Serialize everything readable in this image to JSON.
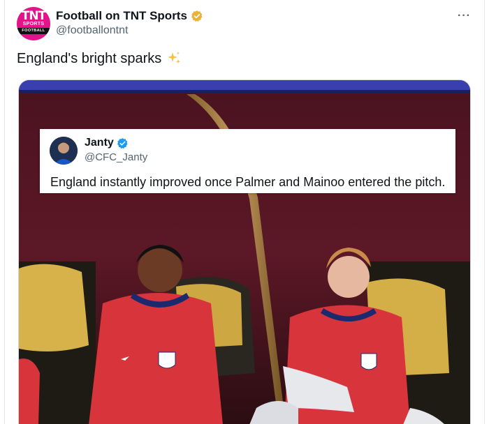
{
  "tweet": {
    "author": {
      "display_name": "Football on TNT Sports",
      "handle": "@footballontnt",
      "verified_badge": "gold-verified-icon",
      "avatar_text": {
        "logo": "TNT",
        "line1": "SPORTS",
        "line2": "FOOTBALL"
      }
    },
    "more_label": "···",
    "text": "England's bright sparks",
    "text_emoji": "sparkles-icon"
  },
  "media": {
    "quoted_post": {
      "display_name": "Janty",
      "handle": "@CFC_Janty",
      "verified_badge": "blue-verified-icon",
      "text": "England instantly improved once Palmer and Mainoo entered the pitch."
    }
  },
  "colors": {
    "brand_pink": "#e4138a",
    "text_primary": "#0f1419",
    "text_secondary": "#536471",
    "verified_gold": "#e8b339",
    "verified_blue": "#1d9bf0",
    "kit_red": "#d8343c"
  }
}
